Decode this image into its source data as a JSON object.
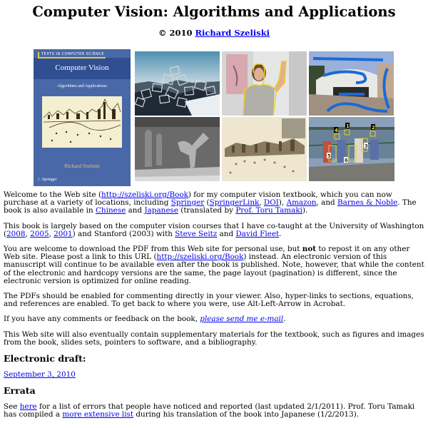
{
  "page": {
    "title": "Computer Vision: Algorithms and Applications",
    "byline_prefix": "© 2010 ",
    "author_link": "Richard Szeliski"
  },
  "cover": {
    "series": "TEXTS IN COMPUTER SCIENCE",
    "title": "Computer Vision",
    "subtitle": "Algorithms and Applications",
    "author": "Richard Szeliski",
    "publisher": "Springer"
  },
  "gallery": [
    {
      "name": "panorama-stitching-image"
    },
    {
      "name": "person-segmentation-image"
    },
    {
      "name": "interactive-segmentation-image"
    },
    {
      "name": "depth-map-image"
    },
    {
      "name": "photo-tourism-image"
    },
    {
      "name": "face-detection-image",
      "labels": [
        "4",
        "1",
        "2",
        "5",
        "3",
        "6"
      ]
    }
  ],
  "intro": {
    "p1": {
      "t1": "Welcome to the Web site (",
      "url": "http://szeliski.org/Book",
      "t2": ") for my computer vision textbook, which you can now purchase at a variety of locations, including ",
      "springer": "Springer",
      "t3": " (",
      "springerlink": "SpringerLink",
      "t4": ", ",
      "doi": "DOI",
      "t5": "), ",
      "amazon": "Amazon",
      "t6": ", and ",
      "bn": "Barnes & Noble",
      "t7": ". The book is also available in ",
      "chinese": "Chinese",
      "t8": " and ",
      "japanese": "Japanese",
      "t9": " (translated by ",
      "tamaki": "Prof. Toru Tamaki",
      "t10": ")."
    },
    "p2": {
      "t1": "This book is largely based on the computer vision courses that I have co-taught at the University of Washington (",
      "y2008": "2008",
      "t2": ", ",
      "y2005": "2005",
      "t3": ", ",
      "y2001": "2001",
      "t4": ") and Stanford (2003) with ",
      "seitz": "Steve Seitz",
      "t5": " and ",
      "fleet": "David Fleet",
      "t6": "."
    },
    "p3": {
      "t1": "You are welcome to download the PDF from this Web site for personal use, but ",
      "bold": "not",
      "t2": " to repost it on any other Web site. Please post a link to this URL (",
      "url": "http://szeliski.org/Book",
      "t3": ") instead. An electronic version of this manuscript will continue to be available even after the book is published. Note, however, that while the content of the electronic and hardcopy versions are the same, the page layout (pagination) is different, since the electronic version is optimized for online reading."
    },
    "p4": "The PDFs should be enabled for commenting directly in your viewer. Also, hyper-links to sections, equations, and references are enabled. To get back to where you were, use Alt-Left-Arrow in Acrobat.",
    "p5": {
      "t1": "If you have any comments or feedback on the book, ",
      "email": "please send me e-mail",
      "t2": "."
    },
    "p6": "This Web site will also eventually contain supplementary materials for the textbook, such as figures and images from the book, slides sets, pointers to software, and a bibliography."
  },
  "draft": {
    "heading": "Electronic draft:",
    "link": "September 3, 2010"
  },
  "errata": {
    "heading": "Errata",
    "t1": "See ",
    "here": "here",
    "t2": " for a list of errors that people have noticed and reported (last updated 2/1/2011). Prof. Toru Tamaki has compiled a ",
    "more": "more extensive list",
    "t3": " during his translation of the book into Japanese (1/2/2013)."
  }
}
